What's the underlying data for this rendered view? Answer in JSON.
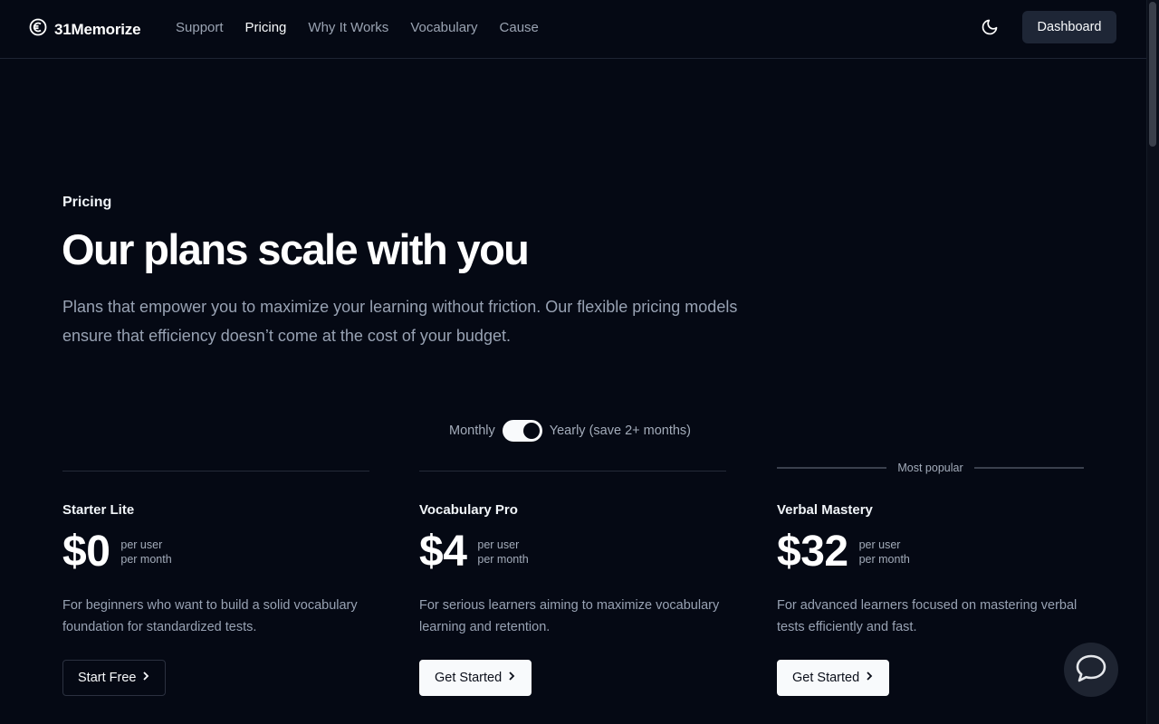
{
  "header": {
    "brand": "31Memorize",
    "nav": [
      "Support",
      "Pricing",
      "Why It Works",
      "Vocabulary",
      "Cause"
    ],
    "active_nav": "Pricing",
    "dashboard_label": "Dashboard",
    "theme_icon": "moon-icon",
    "logo_icon": "euro-circle-icon"
  },
  "hero": {
    "eyebrow": "Pricing",
    "title": "Our plans scale with you",
    "description": "Plans that empower you to maximize your learning without friction. Our flexible pricing models ensure that efficiency doesn’t come at the cost of your budget."
  },
  "billing_toggle": {
    "left_label": "Monthly",
    "right_label": "Yearly (save 2+ months)",
    "selected": "Yearly"
  },
  "plans": [
    {
      "name": "Starter Lite",
      "price": "$0",
      "unit_line1": "per user",
      "unit_line2": "per month",
      "description": "For beginners who want to build a solid vocabulary foundation for standardized tests.",
      "button": "Start Free",
      "button_style": "outline"
    },
    {
      "name": "Vocabulary Pro",
      "price": "$4",
      "unit_line1": "per user",
      "unit_line2": "per month",
      "description": "For serious learners aiming to maximize vocabulary learning and retention.",
      "button": "Get Started",
      "button_style": "solid"
    },
    {
      "name": "Verbal Mastery",
      "price": "$32",
      "unit_line1": "per user",
      "unit_line2": "per month",
      "description": "For advanced learners focused on mastering verbal tests efficiently and fast.",
      "button": "Get Started",
      "button_style": "solid",
      "badge": "Most popular"
    }
  ],
  "chat": {
    "icon": "chat-bubble-icon"
  },
  "colors": {
    "background": "#050914",
    "accent_button": "#f8fafc",
    "dashboard_button": "#1e2636"
  }
}
